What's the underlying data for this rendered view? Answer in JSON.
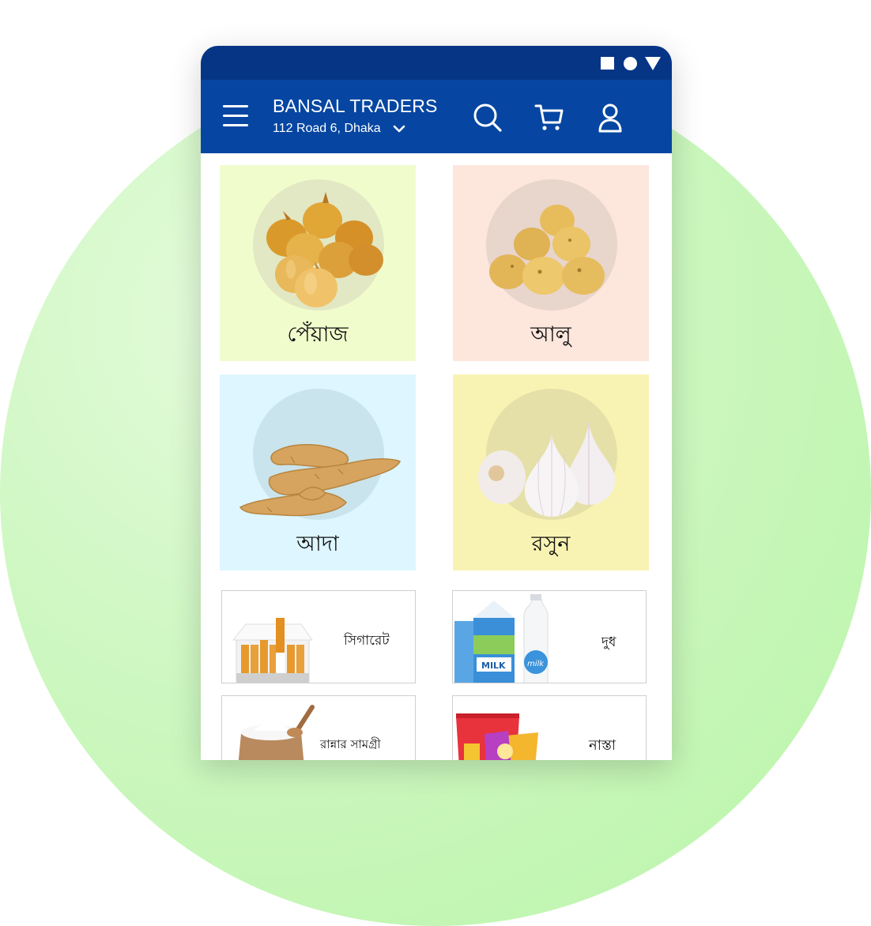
{
  "status_bar": {
    "icons": [
      "square-icon",
      "circle-icon",
      "triangle-icon"
    ],
    "background": "#063586"
  },
  "app_bar": {
    "store_name": "BANSAL TRADERS",
    "address": "112 Road 6, Dhaka",
    "icons": [
      "menu-icon",
      "chevron-down-icon",
      "search-icon",
      "cart-icon",
      "user-icon"
    ],
    "background": "#0646a2"
  },
  "categories": [
    {
      "label": "পেঁয়াজ",
      "image": "onion-image",
      "color": "#f1fccc"
    },
    {
      "label": "আলু",
      "image": "potato-image",
      "color": "#fde6dc"
    },
    {
      "label": "আদা",
      "image": "ginger-image",
      "color": "#ddf6ff"
    },
    {
      "label": "রসুন",
      "image": "garlic-image",
      "color": "#f8f3b2"
    }
  ],
  "products": [
    {
      "label": "সিগারেট",
      "image": "cigarette-image"
    },
    {
      "label": "দুধ",
      "image": "milk-image"
    },
    {
      "label": "রান্নার সামগ্রী",
      "image": "cooking-supplies-image"
    },
    {
      "label": "নাস্তা",
      "image": "snacks-image"
    }
  ],
  "background_circle_color": "#c8f6b9"
}
